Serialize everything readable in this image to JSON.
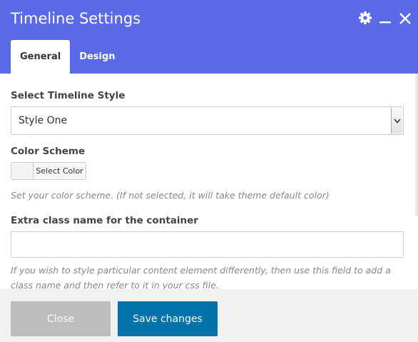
{
  "dialog": {
    "title": "Timeline Settings",
    "icons": [
      "gear-icon",
      "minimize-icon",
      "close-icon"
    ],
    "accent_color": "#5a69e6"
  },
  "tabs": [
    {
      "label": "General",
      "active": true
    },
    {
      "label": "Design",
      "active": false
    }
  ],
  "fields": {
    "style_label": "Select Timeline Style",
    "style_value": "Style One",
    "color_label": "Color Scheme",
    "color_button_label": "Select Color",
    "color_help": "Set your color scheme. (If not selected, it will take theme default color)",
    "class_label": "Extra class name for the container",
    "class_value": "",
    "class_help": "If you wish to style particular content element differently, then use this field to add a class name and then refer to it in your css file."
  },
  "footer": {
    "close_label": "Close",
    "save_label": "Save changes",
    "save_color": "#0073aa"
  }
}
